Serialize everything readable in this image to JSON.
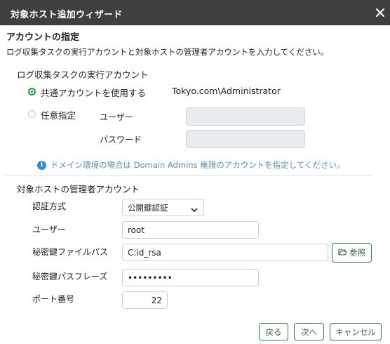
{
  "window": {
    "title": "対象ホスト追加ウィザード",
    "close_icon": "close-icon"
  },
  "section": {
    "title": "アカウントの指定",
    "description": "ログ収集タスクの実行アカウントと対象ホストの管理者アカウントを入力してください。"
  },
  "exec_account": {
    "title": "ログ収集タスクの実行アカウント",
    "shared_option_label": "共通アカウントを使用する",
    "shared_account_value": "Tokyo.com\\Administrator",
    "custom_option_label": "任意指定",
    "user_label": "ユーザー",
    "user_value": "",
    "password_label": "パスワード",
    "password_value": "",
    "info_text": "ドメイン環境の場合は Domain Admins 権限のアカウントを指定してください。",
    "selected": "shared"
  },
  "admin_account": {
    "title": "対象ホストの管理者アカウント",
    "auth_label": "認証方式",
    "auth_value": "公開鍵認証",
    "user_label": "ユーザー",
    "user_value": "root",
    "keyfile_label": "秘密鍵ファイルパス",
    "keyfile_value": "C:id_rsa",
    "browse_label": "参照",
    "passphrase_label": "秘密鍵パスフレーズ",
    "passphrase_value": "•••••••••",
    "port_label": "ポート番号",
    "port_value": "22"
  },
  "footer": {
    "back_label": "戻る",
    "next_label": "次へ",
    "cancel_label": "キャンセル"
  },
  "colors": {
    "titlebar": "#3f3f3f",
    "accent": "#1e9b3d",
    "info": "#2a8fd6"
  }
}
